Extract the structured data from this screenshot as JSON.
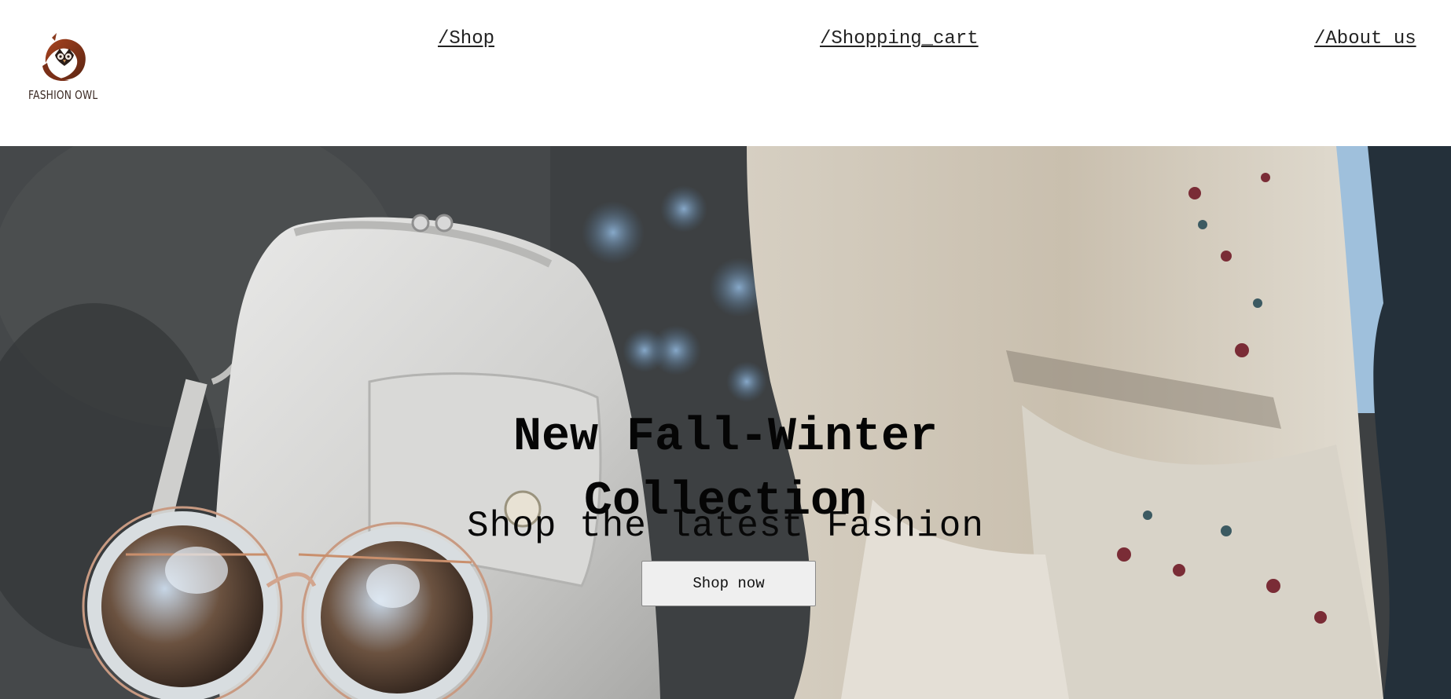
{
  "brand": {
    "name": "FASHION OWL",
    "logo_icon": "owl-logo-icon",
    "colors": {
      "owl_brown": "#8a3a1e",
      "owl_dark": "#3b2a24"
    }
  },
  "nav": {
    "items": [
      {
        "label": "/Shop"
      },
      {
        "label": "/Shopping_cart"
      },
      {
        "label": "/About us"
      }
    ]
  },
  "hero": {
    "title_line1": "New Fall-Winter",
    "title_line2": "Collection",
    "subtitle": "Shop the latest Fashion",
    "cta_label": "Shop now",
    "image_description_icon": "handbag-sunglasses-photo"
  }
}
